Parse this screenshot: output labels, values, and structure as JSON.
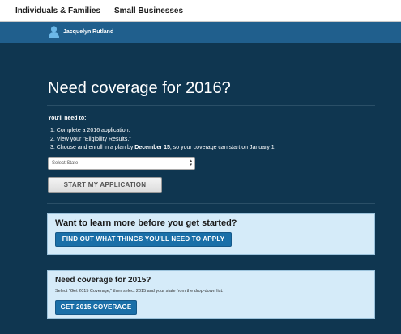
{
  "topnav": {
    "links": [
      {
        "label": "Individuals & Families"
      },
      {
        "label": "Small Businesses"
      }
    ]
  },
  "user": {
    "name": "Jacquelyn Rutland",
    "icon": "user-icon"
  },
  "main": {
    "title": "Need coverage for 2016?",
    "need_label": "You'll need to:",
    "steps": {
      "one": "1. Complete a 2016 application.",
      "two": "2. View your \"Eligibility Results.\"",
      "three_pre": "3. Choose and enroll in a plan by ",
      "three_bold": "December 15",
      "three_post": ", so your coverage can start on January 1."
    },
    "state_select": {
      "selected": "Select State"
    },
    "start_button": "START MY APPLICATION"
  },
  "learn_card": {
    "title": "Want to learn more before you get started?",
    "button": "FIND OUT WHAT THINGS YOU'LL NEED TO APPLY"
  },
  "coverage2015_card": {
    "title": "Need coverage for 2015?",
    "description": "Select \"Get 2015 Coverage,\" then select 2015 and your state from the drop-down list.",
    "button": "GET 2015 COVERAGE"
  },
  "colors": {
    "background": "#0f3650",
    "user_bar": "#205f8d",
    "card": "#d5ebf9",
    "primary_button": "#1a6fa8"
  }
}
